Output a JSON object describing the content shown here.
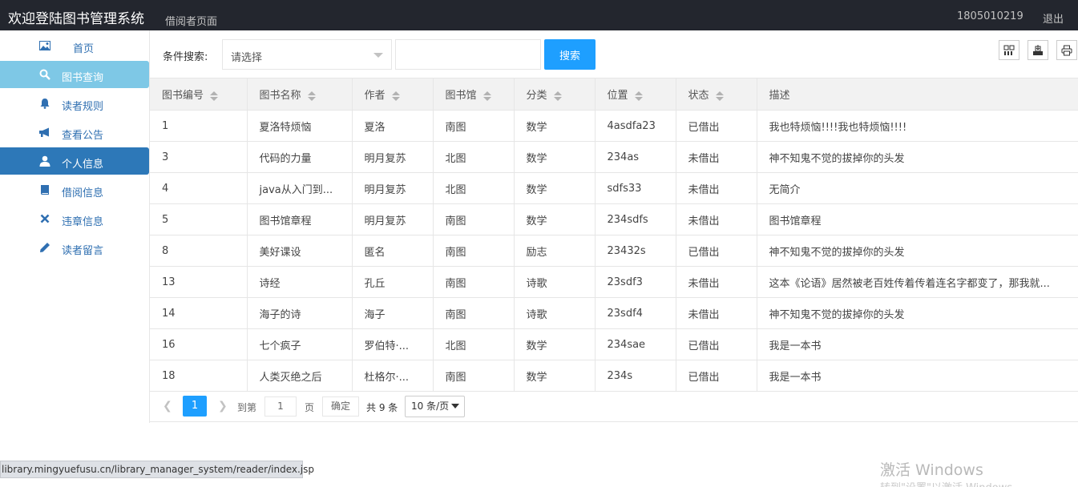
{
  "header": {
    "title": "欢迎登陆图书管理系统",
    "subtitle": "借阅者页面",
    "user": "1805010219",
    "logout": "退出"
  },
  "sidebar": {
    "items": [
      {
        "label": "首页",
        "icon": "image-icon"
      },
      {
        "label": "图书查询",
        "icon": "search-icon"
      },
      {
        "label": "读者规则",
        "icon": "bell-icon"
      },
      {
        "label": "查看公告",
        "icon": "bullhorn-icon"
      },
      {
        "label": "个人信息",
        "icon": "user-icon"
      },
      {
        "label": "借阅信息",
        "icon": "book-icon"
      },
      {
        "label": "违章信息",
        "icon": "close-icon"
      },
      {
        "label": "读者留言",
        "icon": "pencil-icon"
      }
    ]
  },
  "search": {
    "label": "条件搜索:",
    "select_value": "请选择",
    "input_value": "",
    "button": "搜索"
  },
  "toolbar": {
    "icons": [
      "columns-icon",
      "export-icon",
      "print-icon"
    ]
  },
  "table": {
    "columns": [
      "图书编号",
      "图书名称",
      "作者",
      "图书馆",
      "分类",
      "位置",
      "状态",
      "描述"
    ],
    "rows": [
      [
        "1",
        "夏洛特烦恼",
        "夏洛",
        "南图",
        "数学",
        "4asdfa23",
        "已借出",
        "我也特烦恼!!!!我也特烦恼!!!!"
      ],
      [
        "3",
        "代码的力量",
        "明月复苏",
        "北图",
        "数学",
        "234as",
        "未借出",
        "神不知鬼不觉的拔掉你的头发"
      ],
      [
        "4",
        "java从入门到...",
        "明月复苏",
        "北图",
        "数学",
        "sdfs33",
        "未借出",
        "无简介"
      ],
      [
        "5",
        "图书馆章程",
        "明月复苏",
        "南图",
        "数学",
        "234sdfs",
        "未借出",
        "图书馆章程"
      ],
      [
        "8",
        "美好课设",
        "匿名",
        "南图",
        "励志",
        "23432s",
        "已借出",
        "神不知鬼不觉的拔掉你的头发"
      ],
      [
        "13",
        "诗经",
        "孔丘",
        "南图",
        "诗歌",
        "23sdf3",
        "未借出",
        "这本《论语》居然被老百姓传着传着连名字都变了，那我就..."
      ],
      [
        "14",
        "海子的诗",
        "海子",
        "南图",
        "诗歌",
        "23sdf4",
        "未借出",
        "神不知鬼不觉的拔掉你的头发"
      ],
      [
        "16",
        "七个疯子",
        "罗伯特·...",
        "北图",
        "数学",
        "234sae",
        "已借出",
        "我是一本书"
      ],
      [
        "18",
        "人类灭绝之后",
        "杜格尔·...",
        "南图",
        "数学",
        "234s",
        "已借出",
        "我是一本书"
      ]
    ]
  },
  "pager": {
    "current": "1",
    "goto": "到第",
    "page_input": "1",
    "page_unit": "页",
    "confirm": "确定",
    "total": "共 9 条",
    "size": "10 条/页"
  },
  "browser": {
    "status_url": "library.mingyuefusu.cn/library_manager_system/reader/index.jsp"
  },
  "watermark": {
    "line1": "激活 Windows",
    "line2": "转到\"设置\"以激活 Windows。"
  },
  "colors": {
    "topbar": "#23262e",
    "accent": "#1e9fff",
    "sidebar_active": "#2d78b8",
    "sidebar_hover": "#7ec8e6",
    "borrowed": "#ff9800",
    "available": "#137a13"
  }
}
